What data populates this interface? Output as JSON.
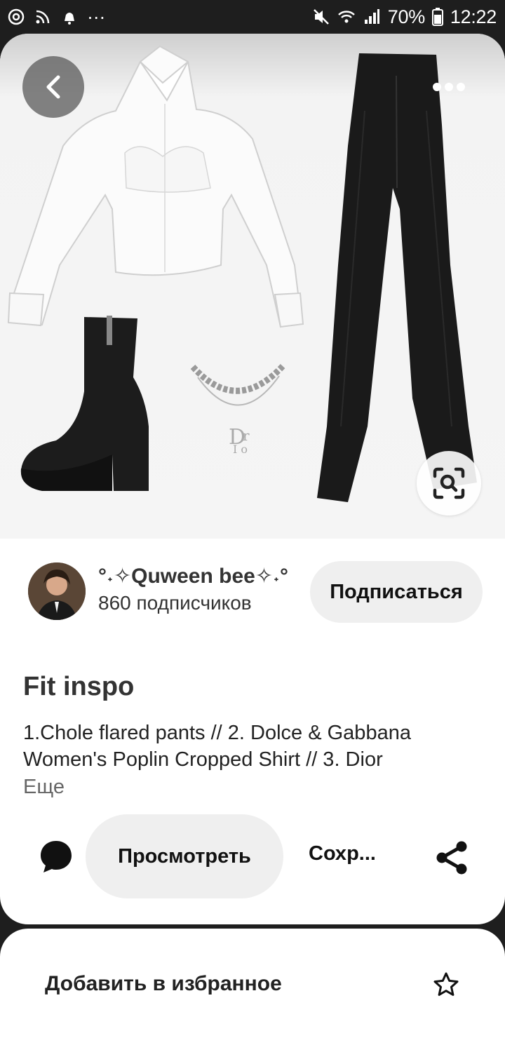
{
  "status_bar": {
    "battery": "70%",
    "time": "12:22",
    "dots": "···"
  },
  "pin": {
    "title": "Fit inspo",
    "description": "1.Chole flared pants // 2. Dolce & Gabbana Women's Poplin Cropped Shirt // 3. Dior",
    "more_label": "Еще"
  },
  "creator": {
    "name": "°˖✧Quween bee✧˖°",
    "followers": "860 подписчиков",
    "follow_label": "Подписаться"
  },
  "actions": {
    "view_label": "Просмотреть",
    "save_label": "Сохр..."
  },
  "sheet": {
    "favorite_label": "Добавить в избранное"
  },
  "icons": {
    "back": "chevron-left-icon",
    "more": "more-dots-icon",
    "lens": "visual-search-icon",
    "comment": "comment-bubble-icon",
    "share": "share-icon",
    "star": "star-outline-icon"
  },
  "colors": {
    "pill_bg": "#efefef",
    "status_bg": "#1e1e1e"
  }
}
